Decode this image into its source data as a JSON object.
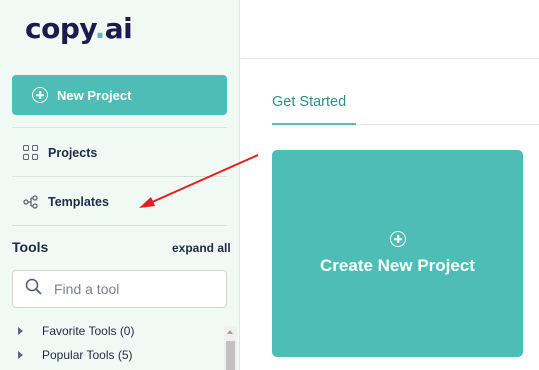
{
  "app": {
    "logo_text_1": "copy",
    "logo_dot": ".",
    "logo_text_2": "ai"
  },
  "sidebar": {
    "new_project_label": "New Project",
    "nav": [
      {
        "label": "Projects",
        "icon": "grid-icon"
      },
      {
        "label": "Templates",
        "icon": "share-nodes-icon"
      }
    ],
    "tools_title": "Tools",
    "expand_all": "expand all",
    "search": {
      "placeholder": "Find a tool",
      "value": ""
    },
    "tool_groups": [
      {
        "label": "Favorite Tools (0)"
      },
      {
        "label": "Popular Tools (5)"
      }
    ]
  },
  "main": {
    "tab_label": "Get Started",
    "create_card_label": "Create New Project"
  },
  "colors": {
    "accent": "#4dbdb6",
    "sidebar_bg": "#f1f9f5",
    "annotation_arrow": "#e02020"
  }
}
